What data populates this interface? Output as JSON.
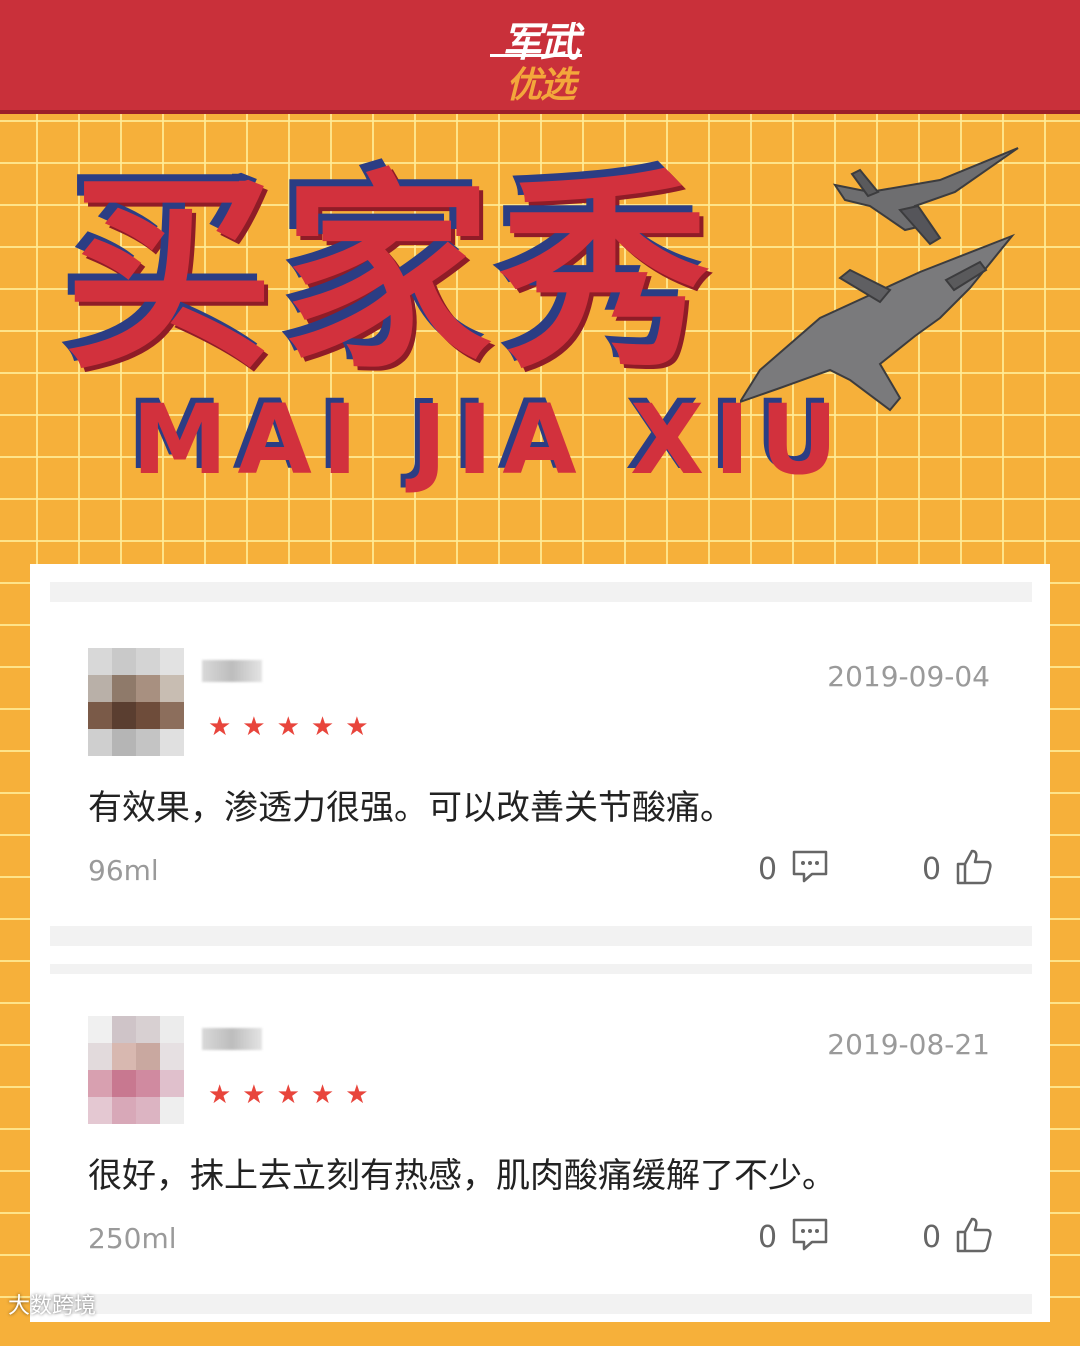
{
  "header": {
    "logo_top": "军武",
    "logo_bottom": "优选"
  },
  "banner": {
    "title_cn": "买家秀",
    "title_en": "MAI JIA XIU"
  },
  "reviews": [
    {
      "date": "2019-09-04",
      "stars": "★★★★★",
      "text": "有效果，渗透力很强。可以改善关节酸痛。",
      "spec": "96ml",
      "comment_count": "0",
      "like_count": "0"
    },
    {
      "date": "2019-08-21",
      "stars": "★★★★★",
      "text": "很好，抹上去立刻有热感，肌肉酸痛缓解了不少。",
      "spec": "250ml",
      "comment_count": "0",
      "like_count": "0"
    }
  ],
  "watermark": "大数跨境",
  "colors": {
    "header_red": "#c9303a",
    "grid_orange": "#f6b03a",
    "star_red": "#e8453c"
  }
}
